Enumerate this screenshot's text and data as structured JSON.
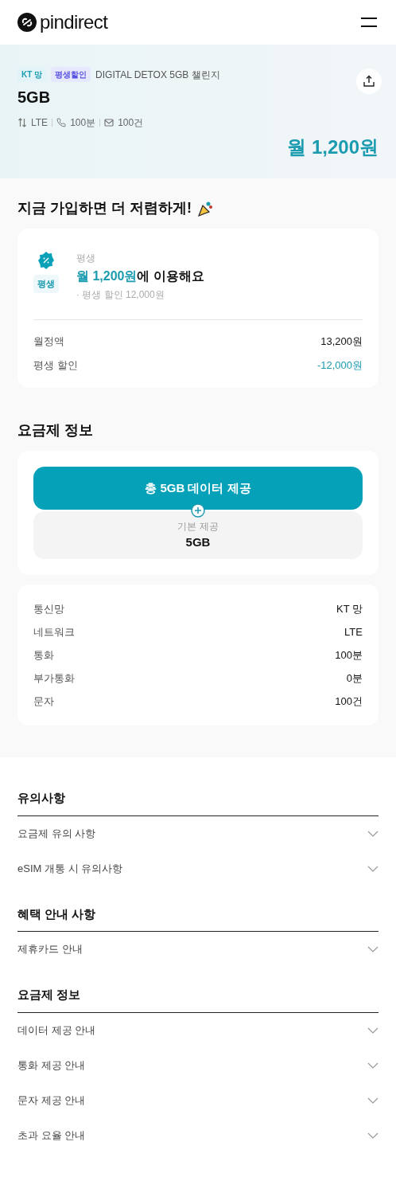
{
  "header": {
    "logo": "pindirect"
  },
  "hero": {
    "tags": [
      {
        "label": "KT 망",
        "kind": "network"
      },
      {
        "label": "평생할인",
        "kind": "discount"
      }
    ],
    "plan_name": "DIGITAL DETOX 5GB 챌린지",
    "title": "5GB",
    "specs": [
      {
        "kind": "data",
        "label": "LTE"
      },
      {
        "kind": "call",
        "label": "100분"
      },
      {
        "kind": "sms",
        "label": "100건"
      }
    ],
    "price": "월 1,200원"
  },
  "promo": {
    "heading": "지금 가입하면 더 저렴하게!",
    "badge": "평생",
    "caption": "평생",
    "price_highlight": "월 1,200원",
    "price_rest": "에 이용해요",
    "note": "· 평생 할인 12,000원",
    "rows": [
      {
        "label": "월정액",
        "value": "13,200원",
        "kind": "normal"
      },
      {
        "label": "평생 할인",
        "value": "-12,000원",
        "kind": "discount"
      }
    ]
  },
  "plan_info": {
    "heading": "요금제 정보",
    "total": "총 5GB 데이터 제공",
    "base_label": "기본 제공",
    "base_value": "5GB",
    "rows": [
      {
        "label": "통신망",
        "value": "KT 망"
      },
      {
        "label": "네트워크",
        "value": "LTE"
      },
      {
        "label": "통화",
        "value": "100분"
      },
      {
        "label": "부가통화",
        "value": "0분"
      },
      {
        "label": "문자",
        "value": "100건"
      }
    ]
  },
  "accordions": [
    {
      "title": "유의사항",
      "items": [
        {
          "label": "요금제 유의 사항",
          "expanded": false
        },
        {
          "label": "eSIM 개통 시 유의사항",
          "expanded": false
        }
      ]
    },
    {
      "title": "혜택 안내 사항",
      "items": [
        {
          "label": "제휴카드 안내",
          "expanded": false
        }
      ]
    },
    {
      "title": "요금제 정보",
      "items": [
        {
          "label": "데이터 제공 안내",
          "expanded": false
        },
        {
          "label": "통화 제공 안내",
          "expanded": false
        },
        {
          "label": "문자 제공 안내",
          "expanded": false
        },
        {
          "label": "초과 요율 안내",
          "expanded": false
        }
      ]
    }
  ]
}
